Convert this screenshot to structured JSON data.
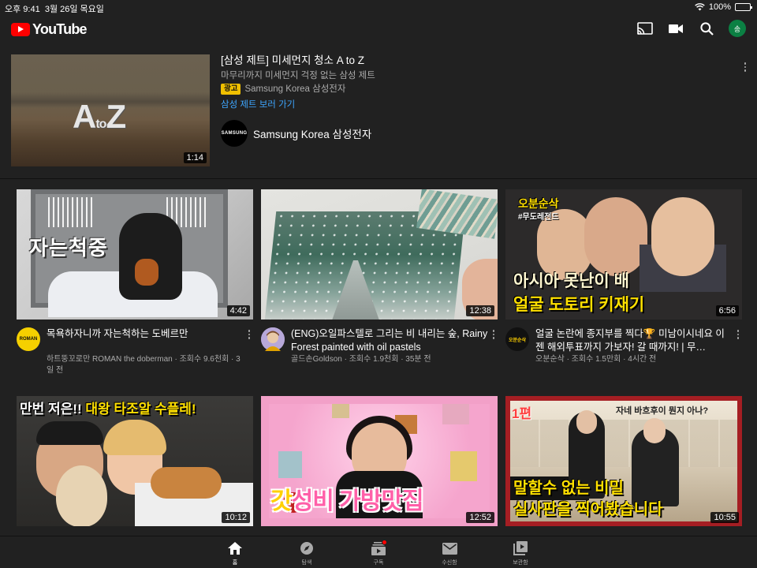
{
  "status_bar": {
    "time": "오후 9:41",
    "date": "3월 26일 목요일",
    "battery": "100%",
    "battery_level": 1.0
  },
  "header": {
    "logo_text": "YouTube",
    "avatar_initial": "송",
    "icons": [
      "cast-icon",
      "camera-icon",
      "search-icon",
      "account-avatar"
    ]
  },
  "ad": {
    "title": "[삼성 제트] 미세먼지 청소 A to Z",
    "description": "마무리까지 미세먼지 걱정 없는 삼성 제트",
    "badge": "광고",
    "advertiser": "Samsung Korea 삼성전자",
    "cta": "삼성 제트 보러 가기",
    "channel_logo_text": "SAMSUNG",
    "channel_name": "Samsung Korea 삼성전자",
    "duration": "1:14",
    "thumb_text_big": "A",
    "thumb_text_small": "to",
    "thumb_text_big2": "Z"
  },
  "videos": [
    {
      "title": "목욕하자니까 자는척하는 도베르만",
      "subtitle": "하트뚱꼬로만 ROMAN the doberman · 조회수 9.6천회 · 3일 전",
      "duration": "4:42",
      "thumb_caption": "자는척중",
      "avatar_text": "ROMAN",
      "avatar_color": "#f5d000"
    },
    {
      "title": "(ENG)오일파스텔로 그리는 비 내리는 숲, Rainy Forest painted with oil pastels",
      "subtitle": "골드손Goldson · 조회수 1.9천회 · 35분 전",
      "duration": "12:38",
      "avatar_text": "",
      "avatar_color": "#9b8fc0"
    },
    {
      "title": "얼굴 논란에 종지부를 찍다🏆 미남이시네요 이젠 해외투표까지 가보자! 갈 때까지! | 무…",
      "subtitle": "오분순삭 · 조회수 1.5만회 · 4시간 전",
      "duration": "6:56",
      "thumb_tag": "오분순삭",
      "thumb_tag2": "#무도레전드",
      "thumb_line1": "아시아 못난이 배",
      "thumb_line2": "얼굴 도토리 키재기",
      "avatar_text": "오분순삭",
      "avatar_color": "#111111"
    },
    {
      "title": "",
      "subtitle": "",
      "duration": "10:12",
      "thumb_title_a": "만번 저은!! ",
      "thumb_title_b": "대왕 타조알 수플레!",
      "avatar_text": "",
      "avatar_color": "#444444"
    },
    {
      "title": "",
      "subtitle": "",
      "duration": "12:52",
      "thumb_caption_a": "갓",
      "thumb_caption_b": "성비 가방맛집",
      "avatar_text": "",
      "avatar_color": "#444444"
    },
    {
      "title": "",
      "subtitle": "",
      "duration": "10:55",
      "thumb_ep": "1편",
      "thumb_question": "자네 바흐후이 뭔지 아나?",
      "thumb_line1": "말할수 없는 비밀",
      "thumb_line2": "실사판을 찍어봤습니다",
      "avatar_text": "",
      "avatar_color": "#444444"
    }
  ],
  "bottom_nav": [
    {
      "label": "홈",
      "icon": "home-icon",
      "active": true
    },
    {
      "label": "탐색",
      "icon": "explore-icon",
      "active": false
    },
    {
      "label": "구독",
      "icon": "subscriptions-icon",
      "active": false,
      "badge": true
    },
    {
      "label": "수신함",
      "icon": "inbox-icon",
      "active": false
    },
    {
      "label": "보관함",
      "icon": "library-icon",
      "active": false
    }
  ],
  "colors": {
    "background": "#212121",
    "accent": "#ff0000",
    "link": "#3ea6ff",
    "ad_badge": "#f0c000"
  }
}
